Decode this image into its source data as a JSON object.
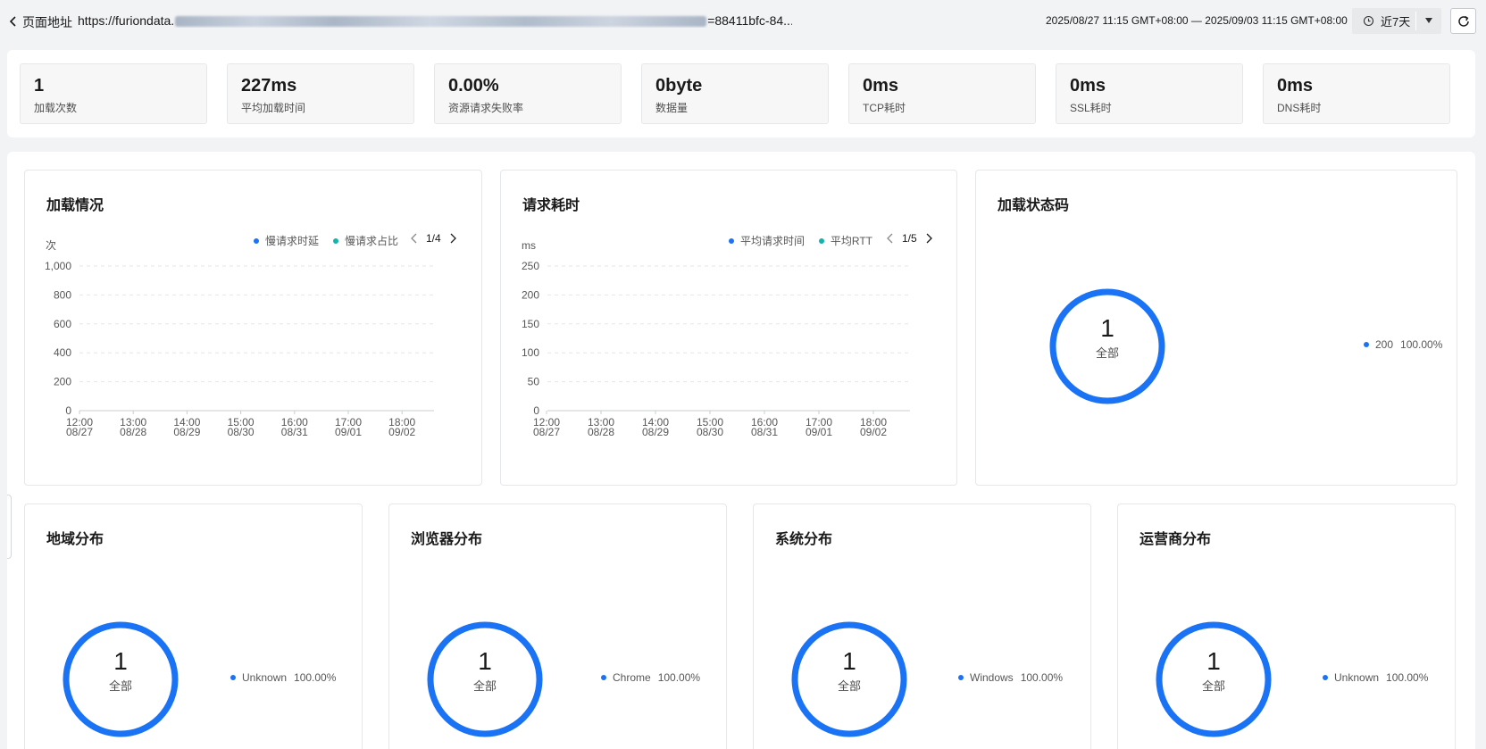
{
  "header": {
    "url_label": "页面地址",
    "url_prefix": "https://furiondata.",
    "url_suffix": "=88411bfc-84...",
    "time_range": "2025/08/27 11:15 GMT+08:00 — 2025/09/03 11:15 GMT+08:00",
    "period": "近7天"
  },
  "stats": [
    {
      "value": "1",
      "label": "加载次数"
    },
    {
      "value": "227ms",
      "label": "平均加载时间"
    },
    {
      "value": "0.00%",
      "label": "资源请求失败率"
    },
    {
      "value": "0byte",
      "label": "数据量"
    },
    {
      "value": "0ms",
      "label": "TCP耗时"
    },
    {
      "value": "0ms",
      "label": "SSL耗时"
    },
    {
      "value": "0ms",
      "label": "DNS耗时"
    }
  ],
  "load_chart": {
    "title": "加载情况",
    "legend": [
      {
        "name": "慢请求时延",
        "color": "#1a73f5"
      },
      {
        "name": "慢请求占比",
        "color": "#12b3a8"
      }
    ],
    "page": "1/4"
  },
  "request_chart": {
    "title": "请求耗时",
    "legend": [
      {
        "name": "平均请求时间",
        "color": "#1a73f5"
      },
      {
        "name": "平均RTT",
        "color": "#12b3a8"
      }
    ],
    "page": "1/5"
  },
  "chart_data": [
    {
      "type": "line",
      "title": "加载情况",
      "ylabel": "次",
      "ylim": [
        0,
        1000
      ],
      "y_ticks": [
        "1,000",
        "800",
        "600",
        "400",
        "200",
        "0"
      ],
      "x": [
        [
          "12:00",
          "08/27"
        ],
        [
          "13:00",
          "08/28"
        ],
        [
          "14:00",
          "08/29"
        ],
        [
          "15:00",
          "08/30"
        ],
        [
          "16:00",
          "08/31"
        ],
        [
          "17:00",
          "09/01"
        ],
        [
          "18:00",
          "09/02"
        ]
      ],
      "grid": true,
      "legend_position": "top-right",
      "series": [
        {
          "name": "慢请求时延",
          "values": []
        },
        {
          "name": "慢请求占比",
          "values": []
        }
      ]
    },
    {
      "type": "line",
      "title": "请求耗时",
      "ylabel": "ms",
      "ylim": [
        0,
        250
      ],
      "y_ticks": [
        "250",
        "200",
        "150",
        "100",
        "50",
        "0"
      ],
      "x": [
        [
          "12:00",
          "08/27"
        ],
        [
          "13:00",
          "08/28"
        ],
        [
          "14:00",
          "08/29"
        ],
        [
          "15:00",
          "08/30"
        ],
        [
          "16:00",
          "08/31"
        ],
        [
          "17:00",
          "09/01"
        ],
        [
          "18:00",
          "09/02"
        ]
      ],
      "grid": true,
      "legend_position": "top-right",
      "series": [
        {
          "name": "平均请求时间",
          "values": []
        },
        {
          "name": "平均RTT",
          "values": []
        }
      ]
    },
    {
      "type": "pie",
      "title": "加载状态码",
      "total": "1",
      "center_label": "全部",
      "slices": [
        {
          "name": "200",
          "value": 1,
          "percent": "100.00%",
          "color": "#1a73f5"
        }
      ]
    },
    {
      "type": "pie",
      "title": "地域分布",
      "total": "1",
      "center_label": "全部",
      "slices": [
        {
          "name": "Unknown",
          "value": 1,
          "percent": "100.00%",
          "color": "#1a73f5"
        }
      ]
    },
    {
      "type": "pie",
      "title": "浏览器分布",
      "total": "1",
      "center_label": "全部",
      "slices": [
        {
          "name": "Chrome",
          "value": 1,
          "percent": "100.00%",
          "color": "#1a73f5"
        }
      ]
    },
    {
      "type": "pie",
      "title": "系统分布",
      "total": "1",
      "center_label": "全部",
      "slices": [
        {
          "name": "Windows",
          "value": 1,
          "percent": "100.00%",
          "color": "#1a73f5"
        }
      ]
    },
    {
      "type": "pie",
      "title": "运营商分布",
      "total": "1",
      "center_label": "全部",
      "slices": [
        {
          "name": "Unknown",
          "value": 1,
          "percent": "100.00%",
          "color": "#1a73f5"
        }
      ]
    }
  ],
  "colors": {
    "accent": "#1a73f5",
    "secondary": "#12b3a8",
    "grid": "#e5e6e8"
  }
}
